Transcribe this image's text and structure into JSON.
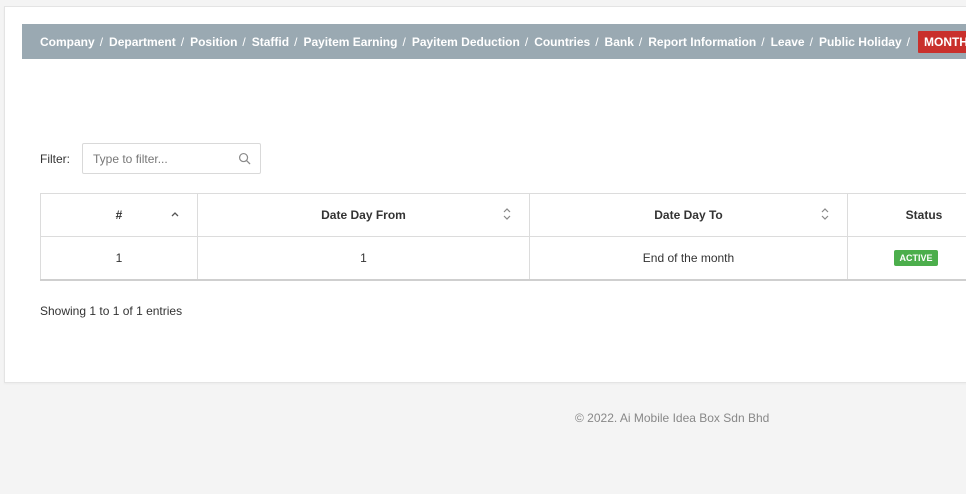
{
  "breadcrumb": {
    "items": [
      "Company",
      "Department",
      "Position",
      "Staffid",
      "Payitem Earning",
      "Payitem Deduction",
      "Countries",
      "Bank",
      "Report Information",
      "Leave",
      "Public Holiday"
    ],
    "active": "MONTHCYCLE",
    "separator": "/"
  },
  "filter": {
    "label": "Filter:",
    "placeholder": "Type to filter...",
    "value": ""
  },
  "table": {
    "columns": [
      "#",
      "Date Day From",
      "Date Day To",
      "Status"
    ],
    "rows": [
      {
        "no": "1",
        "from": "1",
        "to": "End of the month",
        "status": "ACTIVE"
      }
    ]
  },
  "info": "Showing 1 to 1 of 1 entries",
  "footer": "© 2022. Ai Mobile Idea Box Sdn Bhd",
  "colors": {
    "breadcrumb_bg": "#9aa9b2",
    "active_crumb": "#c9302c",
    "status_active": "#4cae4c"
  }
}
